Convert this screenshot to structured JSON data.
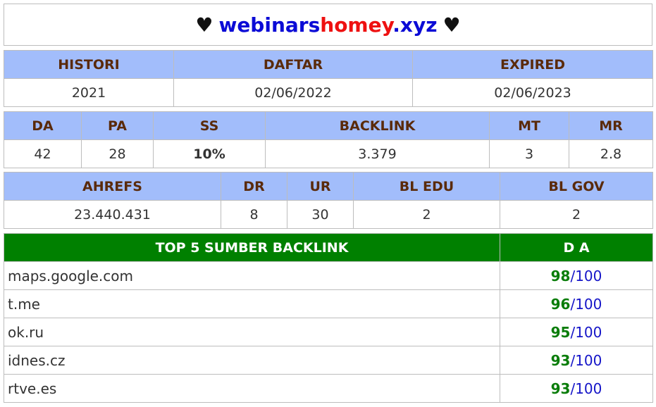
{
  "header": {
    "heart_left": "♥",
    "domain_part1": "webinars",
    "domain_part2": "homey",
    "domain_part3": ".xyz",
    "heart_right": "♥"
  },
  "registration": {
    "headers": [
      "HISTORI",
      "DAFTAR",
      "EXPIRED"
    ],
    "values": [
      "2021",
      "02/06/2022",
      "02/06/2023"
    ]
  },
  "metrics": {
    "headers": [
      "DA",
      "PA",
      "SS",
      "BACKLINK",
      "MT",
      "MR"
    ],
    "values": [
      "42",
      "28",
      "10%",
      "3.379",
      "3",
      "2.8"
    ]
  },
  "ahrefs": {
    "headers": [
      "AHREFS",
      "DR",
      "UR",
      "BL EDU",
      "BL GOV"
    ],
    "values": [
      "23.440.431",
      "8",
      "30",
      "2",
      "2"
    ]
  },
  "top_backlinks": {
    "header_source": "TOP 5 SUMBER BACKLINK",
    "header_da": "D A",
    "slash": "/",
    "max": "100",
    "rows": [
      {
        "site": "maps.google.com",
        "da": "98"
      },
      {
        "site": "t.me",
        "da": "96"
      },
      {
        "site": "ok.ru",
        "da": "95"
      },
      {
        "site": "idnes.cz",
        "da": "93"
      },
      {
        "site": "rtve.es",
        "da": "93"
      }
    ]
  },
  "colors": {
    "header_bg": "#a2bdfb",
    "header_text": "#5a2a0a",
    "green_header_bg": "#008000",
    "score_green": "#0a7d0a",
    "score_blue": "#1515c8",
    "domain_blue": "#0b0bd6",
    "domain_red": "#ee1111"
  }
}
